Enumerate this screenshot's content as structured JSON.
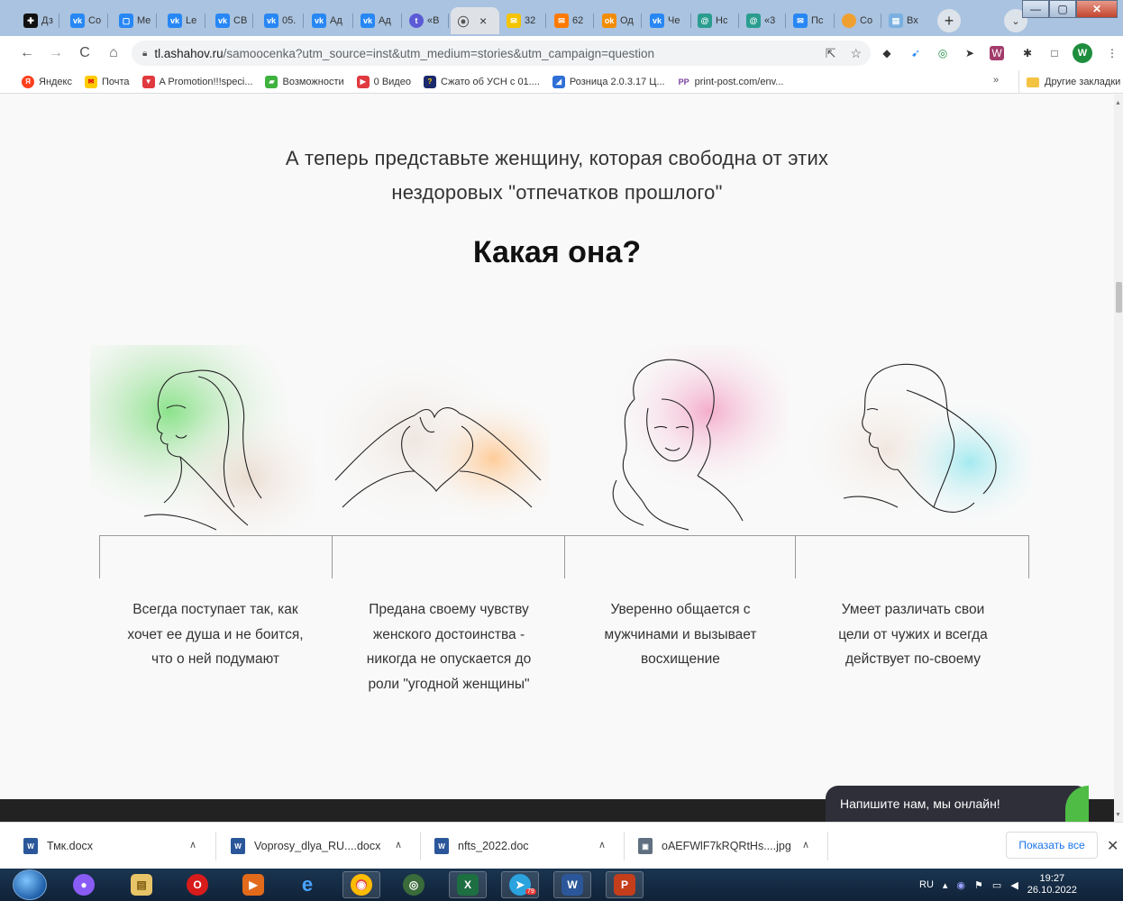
{
  "browser": {
    "tabs": [
      {
        "label": "Дз",
        "icon": "plus-circle-icon",
        "color": "#111111"
      },
      {
        "label": "Co",
        "icon": "vk-icon",
        "color": "#2787f5"
      },
      {
        "label": "Me",
        "icon": "chat-icon",
        "color": "#2787f5"
      },
      {
        "label": "Le",
        "icon": "vk-icon",
        "color": "#2787f5"
      },
      {
        "label": "CB",
        "icon": "vk-icon",
        "color": "#2787f5"
      },
      {
        "label": "05.",
        "icon": "vk-icon",
        "color": "#2787f5"
      },
      {
        "label": "Ад",
        "icon": "vk-icon",
        "color": "#2787f5"
      },
      {
        "label": "Ад",
        "icon": "vk-icon",
        "color": "#2787f5"
      },
      {
        "label": "«В",
        "icon": "telegram-icon",
        "color": "#5b5bd6"
      },
      {
        "label": "",
        "icon": "signal-icon",
        "color": "#555555",
        "active": true
      },
      {
        "label": "32",
        "icon": "mail-icon",
        "color": "#f5c400"
      },
      {
        "label": "62",
        "icon": "envelope-icon",
        "color": "#ff7a00"
      },
      {
        "label": "Од",
        "icon": "ok-icon",
        "color": "#f28c00"
      },
      {
        "label": "Че",
        "icon": "vk-icon",
        "color": "#2787f5"
      },
      {
        "label": "Нс",
        "icon": "at-icon",
        "color": "#2a9d8f"
      },
      {
        "label": "«3",
        "icon": "at-icon",
        "color": "#2a9d8f"
      },
      {
        "label": "Пс",
        "icon": "mail-icon",
        "color": "#2787f5"
      },
      {
        "label": "Co",
        "icon": "circle-icon",
        "color": "#f0a030"
      },
      {
        "label": "Вх",
        "icon": "inbox-icon",
        "color": "#7ab0e0"
      }
    ],
    "active_tab_close": "×",
    "new_tab": "+",
    "tab_search": "⌄",
    "window_buttons": {
      "minimize": "—",
      "maximize": "▢",
      "close": "✕"
    },
    "url_host": "tl.ashahov.ru",
    "url_rest": "/samoocenka?utm_source=inst&utm_medium=stories&utm_campaign=question",
    "profile_initial": "W",
    "bookmarks": [
      {
        "label": "Яндекс",
        "color": "#fc3f1d",
        "glyph": "Я"
      },
      {
        "label": "Почта",
        "color": "#ffcc00",
        "glyph": "✉"
      },
      {
        "label": "A Promotion!!!speci...",
        "color": "#e0393e",
        "glyph": "▼"
      },
      {
        "label": "Возможности",
        "color": "#3fb13f",
        "glyph": "▰"
      },
      {
        "label": "0 Видео",
        "color": "#e0393e",
        "glyph": "▶"
      },
      {
        "label": "Сжато об УСН с 01....",
        "color": "#1a2a6c",
        "glyph": "?"
      },
      {
        "label": "Розница 2.0.3.17 Ц...",
        "color": "#2f6fd6",
        "glyph": "◢"
      },
      {
        "label": "print-post.com/env...",
        "color": "#ffffff",
        "glyph": "PP"
      }
    ],
    "bookmarks_more": "»",
    "other_bookmarks": "Другие закладки"
  },
  "page": {
    "lead_line1": "А теперь представьте женщину, которая свободна от этих",
    "lead_line2": "нездоровых \"отпечатков прошлого\"",
    "question": "Какая она?",
    "features": [
      {
        "line1": "Всегда поступает так, как",
        "line2": "хочет ее душа и не боится,",
        "line3": "что о ней подумают",
        "line4": ""
      },
      {
        "line1": "Предана своему чувству",
        "line2": "женского достоинства -",
        "line3": "никогда не опускается до",
        "line4": "роли \"угодной женщины\""
      },
      {
        "line1": "Уверенно общается с",
        "line2": "мужчинами и вызывает",
        "line3": "восхищение",
        "line4": ""
      },
      {
        "line1": "Умеет различать свои",
        "line2": "цели от чужих и всегда",
        "line3": "действует по-своему",
        "line4": ""
      }
    ],
    "chat_label": "Напишите нам, мы онлайн!"
  },
  "downloads": {
    "items": [
      {
        "name": "Тмк.docx",
        "color": "#2b579a"
      },
      {
        "name": "Voprosy_dlya_RU....docx",
        "color": "#2b579a"
      },
      {
        "name": "nfts_2022.doc",
        "color": "#2b579a"
      },
      {
        "name": "oAEFWlF7kRQRtHs....jpg",
        "color": "#607080"
      }
    ],
    "show_all": "Показать все",
    "close": "✕"
  },
  "taskbar": {
    "apps": [
      {
        "name": "alice",
        "color": "#8a5cf6",
        "glyph": "●"
      },
      {
        "name": "explorer",
        "color": "#e8c468",
        "glyph": "▤"
      },
      {
        "name": "opera",
        "color": "#d81b1b",
        "glyph": "O"
      },
      {
        "name": "media",
        "color": "#e26a1b",
        "glyph": "▶"
      },
      {
        "name": "ie",
        "color": "#2c7be5",
        "glyph": "e"
      },
      {
        "name": "chrome",
        "color": "#e8453c",
        "glyph": "◉"
      },
      {
        "name": "chrome-beta",
        "color": "#3a6b3a",
        "glyph": "◎"
      },
      {
        "name": "excel",
        "color": "#1d6f42",
        "glyph": "X"
      },
      {
        "name": "telegram",
        "color": "#2aa3df",
        "glyph": "➤"
      },
      {
        "name": "word",
        "color": "#2b579a",
        "glyph": "W"
      },
      {
        "name": "powerpoint",
        "color": "#c43e1c",
        "glyph": "P"
      }
    ],
    "telegram_badge": "79",
    "lang": "RU",
    "time": "19:27",
    "date": "26.10.2022"
  }
}
